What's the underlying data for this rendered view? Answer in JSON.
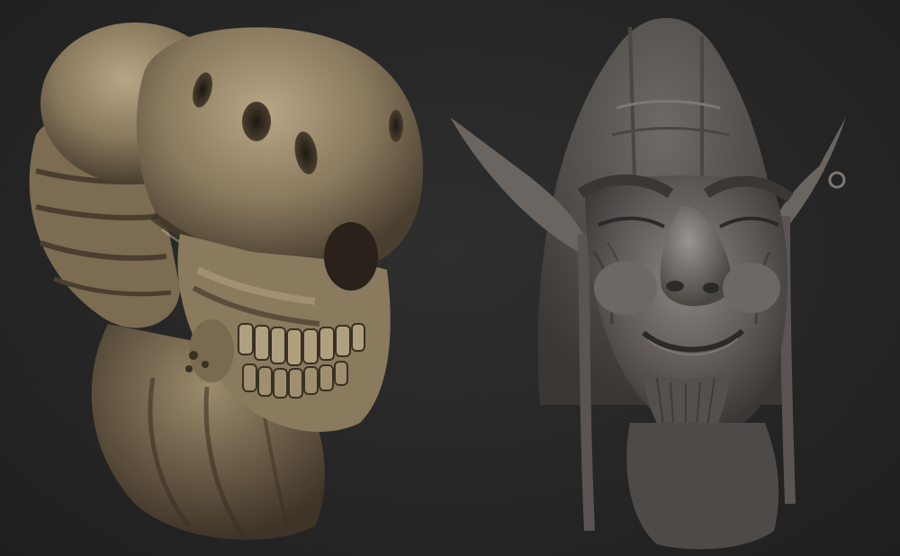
{
  "scene": {
    "background_color": "#272727",
    "renders": [
      {
        "subject": "creature-skull-sculpt",
        "material_color": "#8a7a5e",
        "highlight_color": "#b8a686",
        "shadow_color": "#3a3024"
      },
      {
        "subject": "goblin-head-sculpt",
        "material_color": "#5e5956",
        "highlight_color": "#8c8682",
        "shadow_color": "#2c2a28"
      }
    ]
  }
}
